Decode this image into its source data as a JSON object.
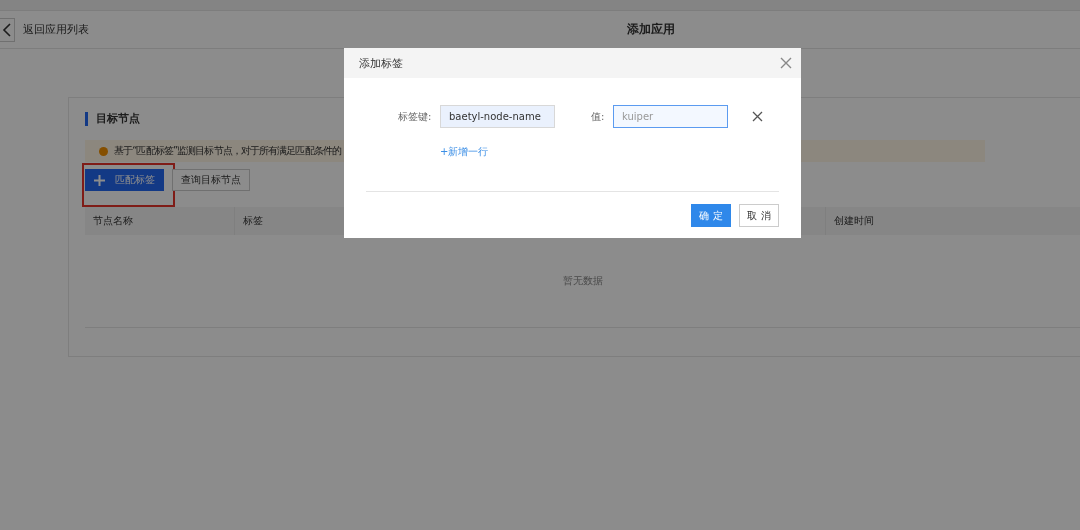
{
  "header": {
    "back_label": "返回应用列表",
    "title": "添加应用"
  },
  "panel": {
    "title": "目标节点",
    "notice": "基于“匹配标签”监测目标节点，对于所有满足匹配条件的",
    "buttons": [
      {
        "kind": "primary",
        "label": "匹配标签",
        "highlighted": true
      },
      {
        "kind": "default",
        "label": "查询目标节点",
        "highlighted": false
      }
    ],
    "table": {
      "columns": [
        "节点名称",
        "标签",
        "创建时间"
      ],
      "empty_text": "暂无数据"
    }
  },
  "dialog": {
    "title": "添加标签",
    "rows": [
      {
        "key_label": "标签键:",
        "key_value": "baetyl-node-name",
        "value_label": "值:",
        "value_placeholder": "kuiper",
        "focused": true
      }
    ],
    "add_row": "+新增一行",
    "buttons": [
      {
        "kind": "primary",
        "label": "确 定"
      },
      {
        "kind": "default",
        "label": "取 消"
      }
    ]
  }
}
